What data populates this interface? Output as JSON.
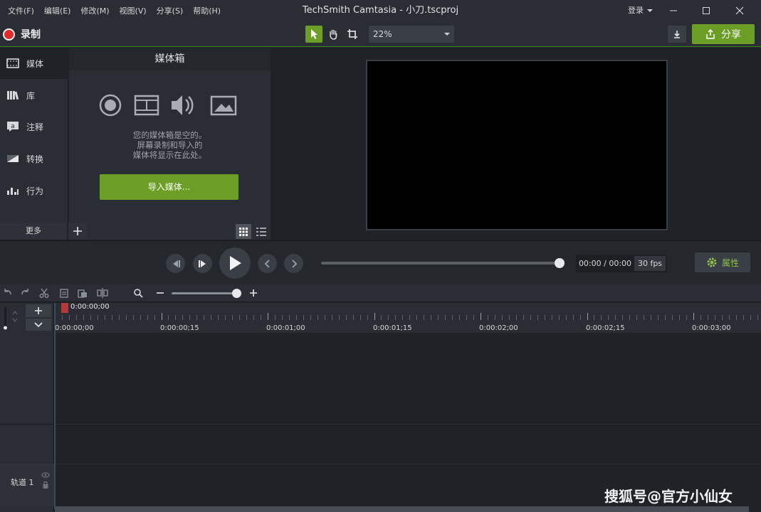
{
  "menu": [
    "文件(F)",
    "编辑(E)",
    "修改(M)",
    "视图(V)",
    "分享(S)",
    "帮助(H)"
  ],
  "window_title": "TechSmith Camtasia - 小刀.tscproj",
  "login_label": "登录",
  "toolbar": {
    "record_label": "录制",
    "zoom_value": "22%",
    "share_label": "分享",
    "accent": "#6c9e27"
  },
  "sidebar": {
    "items": [
      {
        "label": "媒体",
        "icon": "film-icon"
      },
      {
        "label": "库",
        "icon": "library-icon"
      },
      {
        "label": "注释",
        "icon": "annotation-icon"
      },
      {
        "label": "转换",
        "icon": "transition-icon"
      },
      {
        "label": "行为",
        "icon": "behavior-icon"
      }
    ],
    "more_label": "更多"
  },
  "media_bin": {
    "title": "媒体箱",
    "empty_line1": "您的媒体箱是空的。",
    "empty_line2": "屏幕录制和导入的",
    "empty_line3": "媒体将显示在此处。",
    "import_label": "导入媒体..."
  },
  "player": {
    "time": "00:00 / 00:00",
    "fps": "30 fps",
    "properties_label": "属性",
    "progress": 1.0
  },
  "timeline": {
    "playhead_time": "0:00:00;00",
    "ruler_labels": [
      "0:00:00;00",
      "0:00:00;15",
      "0:00:01;00",
      "0:00:01;15",
      "0:00:02;00",
      "0:00:02;15",
      "0:00:03;00"
    ],
    "track_name": "轨道 1"
  },
  "watermark": "搜狐号@官方小仙女"
}
